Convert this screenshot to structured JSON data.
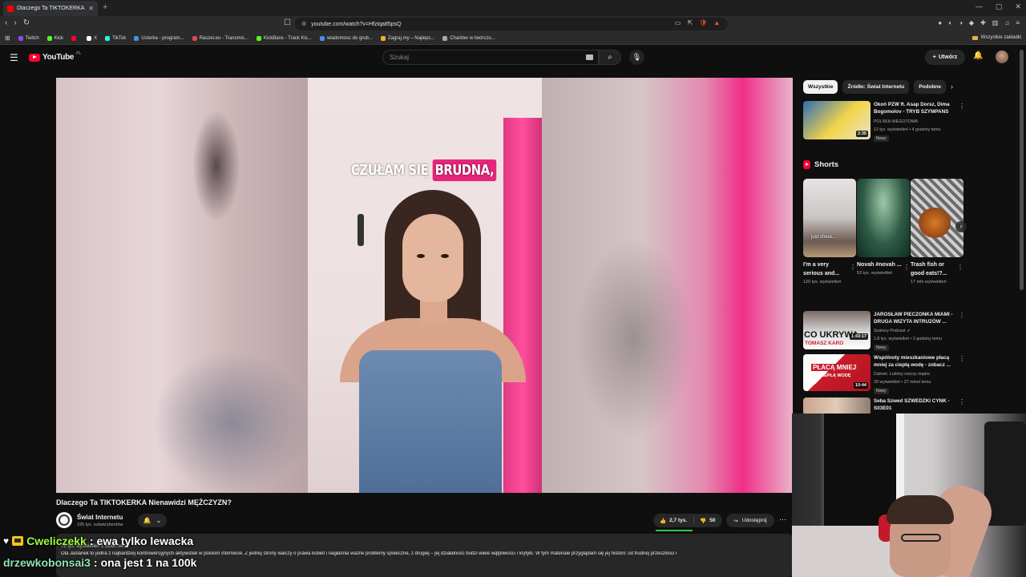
{
  "browser": {
    "tab_title": "Dlaczego Ta TIKTOKERKA Nie...",
    "url": "youtube.com/watch?v=Hfziqa85psQ",
    "bookmarks": [
      {
        "label": "Twitch",
        "color": "#9146ff"
      },
      {
        "label": "Kick",
        "color": "#53fc18"
      },
      {
        "label": "",
        "color": "#ff0033"
      },
      {
        "label": "X",
        "color": "#ffffff"
      },
      {
        "label": "TikTok",
        "color": "#25f4ee"
      },
      {
        "label": "Usterka - program...",
        "color": "#4a90e2"
      },
      {
        "label": "Raszei.eu - Transmis...",
        "color": "#e04a4a"
      },
      {
        "label": "KickBans - Track Kic...",
        "color": "#53fc18"
      },
      {
        "label": "wiadomosc do grub...",
        "color": "#4a90e2"
      },
      {
        "label": "Zagraj.my – Najleps...",
        "color": "#f0b030"
      },
      {
        "label": "Charkter w twórczo...",
        "color": "#aaaaaa"
      }
    ],
    "all_bookmarks": "Wszystkie zakładki"
  },
  "youtube": {
    "logo_text": "YouTube",
    "country": "PL",
    "search_placeholder": "Szukaj",
    "create_label": "Utwórz"
  },
  "video": {
    "caption_plain": "CZUŁAM SIĘ",
    "caption_highlight": "BRUDNA,",
    "title": "Dlaczego Ta TIKTOKERKA Nienawidzi MĘŻCZYZN?",
    "channel": "Świat Internetu",
    "subscribers": "195 tys. subskrybentów",
    "likes": "2,7 tys.",
    "dislikes": "50",
    "share_label": "Udostępnij",
    "description_meta": "76 tys. wyświetleń 1 dzień temu",
    "description": "Ola Jaslanek to jedna z najbardziej kontrowersyjnych aktywistek w polskim internecie. Z jednej strony walczy o prawa kobiet i nagłaśnia ważne problemy społeczne, z drugiej – jej działalność budzi wiele wątpliwości i krytyki. W tym materiale przyglądam się jej historii: od trudnej przeszłości i"
  },
  "chips": [
    "Wszystkie",
    "Źródło: Świat Internetu",
    "Podobne"
  ],
  "related_top": {
    "title": "Okoń PZW ft. Asap Dorsz, Dima Bogomolov - TRYB SZYMPANS",
    "channel": "POLSKA NIEGOTOWA",
    "stats": "12 tys. wyświetleń • 4 godziny temu",
    "badge": "Nowy",
    "duration": "2:35"
  },
  "shorts": {
    "heading": "Shorts",
    "items": [
      {
        "title": "I'm a very serious and...",
        "views": "120 tys. wyświetleń"
      },
      {
        "title": "Novah #novah ...",
        "views": "53 tys. wyświetleń"
      },
      {
        "title": "Trash fish or good eats!?...",
        "views": "17 mln wyświetleń"
      }
    ],
    "thumb_overlay": "just chess..."
  },
  "related": [
    {
      "title": "JAROSŁAW PIECZONKA MIAMI - DRUGA WIZYTA INTRUZÓW ...",
      "channel": "Szalony Podcast",
      "stats": "1,8 tys. wyświetleń • 2 godziny temu",
      "badge": "Nowy",
      "thumb_text": "CO UKRYWA",
      "thumb_sub": "TOMASZ KARO",
      "duration": "1:43:17"
    },
    {
      "title": "Wspólnoty mieszkaniowe płacą mniej za ciepłą wodę - zobacz ...",
      "channel": "Dalmet. Lubimy rzeczy mądre",
      "stats": "20 wyświetleń • 27 minut temu",
      "badge": "Nowy",
      "thumb_text": "PŁACĄ MNIEJ",
      "thumb_sub": "ZA CIEPŁĄ WODĘ",
      "duration": "10:44"
    },
    {
      "title": "Seba Szwed SZWEDZKI CYNK - S03E01",
      "channel": "",
      "stats": "",
      "badge": "",
      "duration": ""
    }
  ],
  "chat": [
    {
      "user": "Cweliczekk",
      "sep": ":",
      "message": "ewa tylko lewacka",
      "color": "#9dff3a"
    },
    {
      "user": "drzewkobonsai3",
      "sep": ":",
      "message": "ona jest 1 na 100k",
      "color": "#8fe3b5"
    }
  ]
}
